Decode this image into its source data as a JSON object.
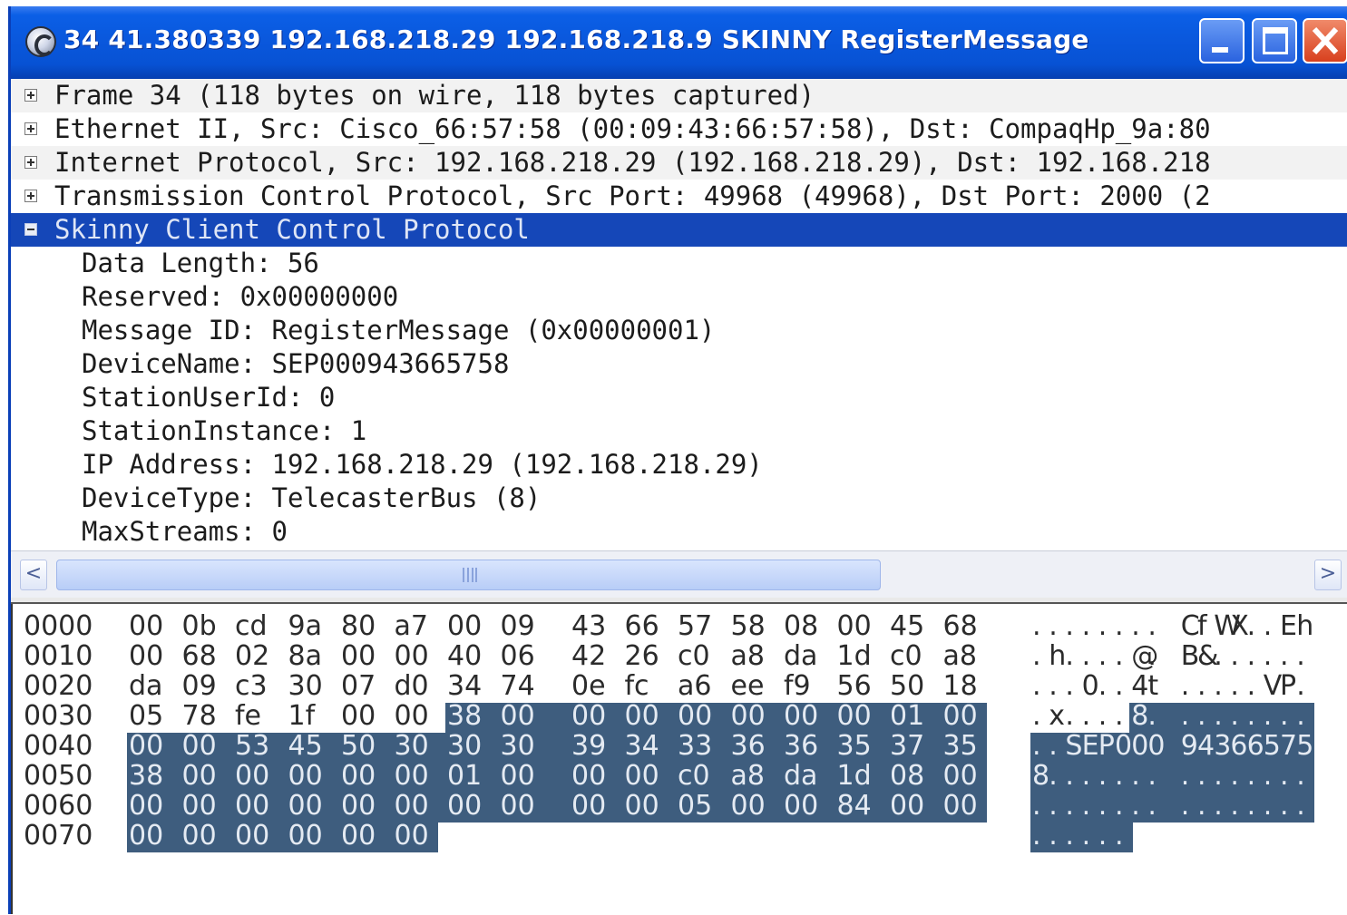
{
  "window": {
    "title": "34 41.380339 192.168.218.29 192.168.218.9 SKINNY RegisterMessage",
    "app_icon": "wireshark-icon",
    "buttons": [
      "minimize-icon",
      "maximize-icon",
      "close-icon"
    ]
  },
  "tree": {
    "items": [
      {
        "expander": "plus",
        "label": "Frame 34 (118 bytes on wire, 118 bytes captured)"
      },
      {
        "expander": "plus",
        "label": "Ethernet II, Src: Cisco_66:57:58 (00:09:43:66:57:58), Dst: CompaqHp_9a:80"
      },
      {
        "expander": "plus",
        "label": "Internet Protocol, Src: 192.168.218.29 (192.168.218.29), Dst: 192.168.218"
      },
      {
        "expander": "plus",
        "label": "Transmission Control Protocol, Src Port: 49968 (49968), Dst Port: 2000 (2"
      },
      {
        "expander": "minus",
        "label": "Skinny Client Control Protocol",
        "selected": true
      }
    ],
    "fields": [
      "Data Length: 56",
      "Reserved: 0x00000000",
      "Message ID: RegisterMessage (0x00000001)",
      "DeviceName: SEP000943665758",
      "StationUserId: 0",
      "StationInstance: 1",
      "IP Address: 192.168.218.29 (192.168.218.29)",
      "DeviceType: TelecasterBus (8)",
      "MaxStreams: 0"
    ]
  },
  "scrollbar": {
    "left_arrow": "<",
    "right_arrow": ">",
    "position_fraction": 0.0,
    "visible_fraction": 0.66
  },
  "hex": {
    "highlight_color": "#3e5d7e",
    "highlight_start_byte": 54,
    "highlight_end_byte": 117,
    "rows": [
      {
        "offset": "0000",
        "bytes": [
          "00",
          "0b",
          "cd",
          "9a",
          "80",
          "a7",
          "00",
          "09",
          "43",
          "66",
          "57",
          "58",
          "08",
          "00",
          "45",
          "68"
        ],
        "ascii": "........ CfWX..Eh"
      },
      {
        "offset": "0010",
        "bytes": [
          "00",
          "68",
          "02",
          "8a",
          "00",
          "00",
          "40",
          "06",
          "42",
          "26",
          "c0",
          "a8",
          "da",
          "1d",
          "c0",
          "a8"
        ],
        "ascii": ".h....@. B&......"
      },
      {
        "offset": "0020",
        "bytes": [
          "da",
          "09",
          "c3",
          "30",
          "07",
          "d0",
          "34",
          "74",
          "0e",
          "fc",
          "a6",
          "ee",
          "f9",
          "56",
          "50",
          "18"
        ],
        "ascii": "...0..4t .....VP."
      },
      {
        "offset": "0030",
        "bytes": [
          "05",
          "78",
          "fe",
          "1f",
          "00",
          "00",
          "38",
          "00",
          "00",
          "00",
          "00",
          "00",
          "00",
          "00",
          "01",
          "00"
        ],
        "ascii": ".x....8. ........"
      },
      {
        "offset": "0040",
        "bytes": [
          "00",
          "00",
          "53",
          "45",
          "50",
          "30",
          "30",
          "30",
          "39",
          "34",
          "33",
          "36",
          "36",
          "35",
          "37",
          "35"
        ],
        "ascii": "..SEP000 94366575"
      },
      {
        "offset": "0050",
        "bytes": [
          "38",
          "00",
          "00",
          "00",
          "00",
          "00",
          "01",
          "00",
          "00",
          "00",
          "c0",
          "a8",
          "da",
          "1d",
          "08",
          "00"
        ],
        "ascii": "8....... ........"
      },
      {
        "offset": "0060",
        "bytes": [
          "00",
          "00",
          "00",
          "00",
          "00",
          "00",
          "00",
          "00",
          "00",
          "00",
          "05",
          "00",
          "00",
          "84",
          "00",
          "00"
        ],
        "ascii": "........ ........"
      },
      {
        "offset": "0070",
        "bytes": [
          "00",
          "00",
          "00",
          "00",
          "00",
          "00"
        ],
        "ascii": "......"
      }
    ]
  }
}
